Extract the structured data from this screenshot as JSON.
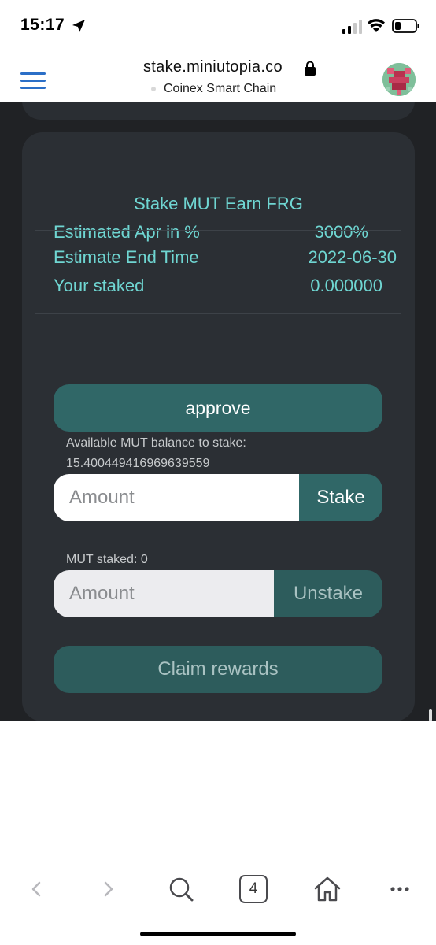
{
  "status_bar": {
    "time": "15:17",
    "icons": [
      "location-arrow-icon",
      "cellular-signal-icon",
      "wifi-icon",
      "battery-icon"
    ]
  },
  "browser": {
    "url": "stake.miniutopia.co",
    "network": "Coinex Smart Chain",
    "icons": [
      "menu-icon",
      "lock-icon",
      "avatar"
    ]
  },
  "stake_card": {
    "title": "Stake MUT Earn FRG",
    "apr_label": "Estimated Apr in %",
    "apr_value": "3000%",
    "end_time_label": "Estimate End Time",
    "end_time_value": "2022-06-30",
    "staked_label": "Your staked",
    "staked_value": "0.000000",
    "approve_label": "approve",
    "available_label": "Available MUT balance to stake:",
    "available_value": "15.400449416969639559",
    "stake_placeholder": "Amount",
    "stake_button": "Stake",
    "mut_staked_label": "MUT staked: 0",
    "unstake_placeholder": "Amount",
    "unstake_button": "Unstake",
    "claim_button": "Claim rewards"
  },
  "bottom_toolbar": {
    "tab_count": "4",
    "icons": [
      "back-icon",
      "forward-icon",
      "search-icon",
      "tabs-icon",
      "home-icon",
      "more-icon"
    ]
  },
  "colors": {
    "page_bg": "#202225",
    "card_bg": "#2b2f34",
    "accent_text": "#6fd6d2",
    "button_bg": "#306767",
    "link_blue": "#2b6fc7"
  }
}
